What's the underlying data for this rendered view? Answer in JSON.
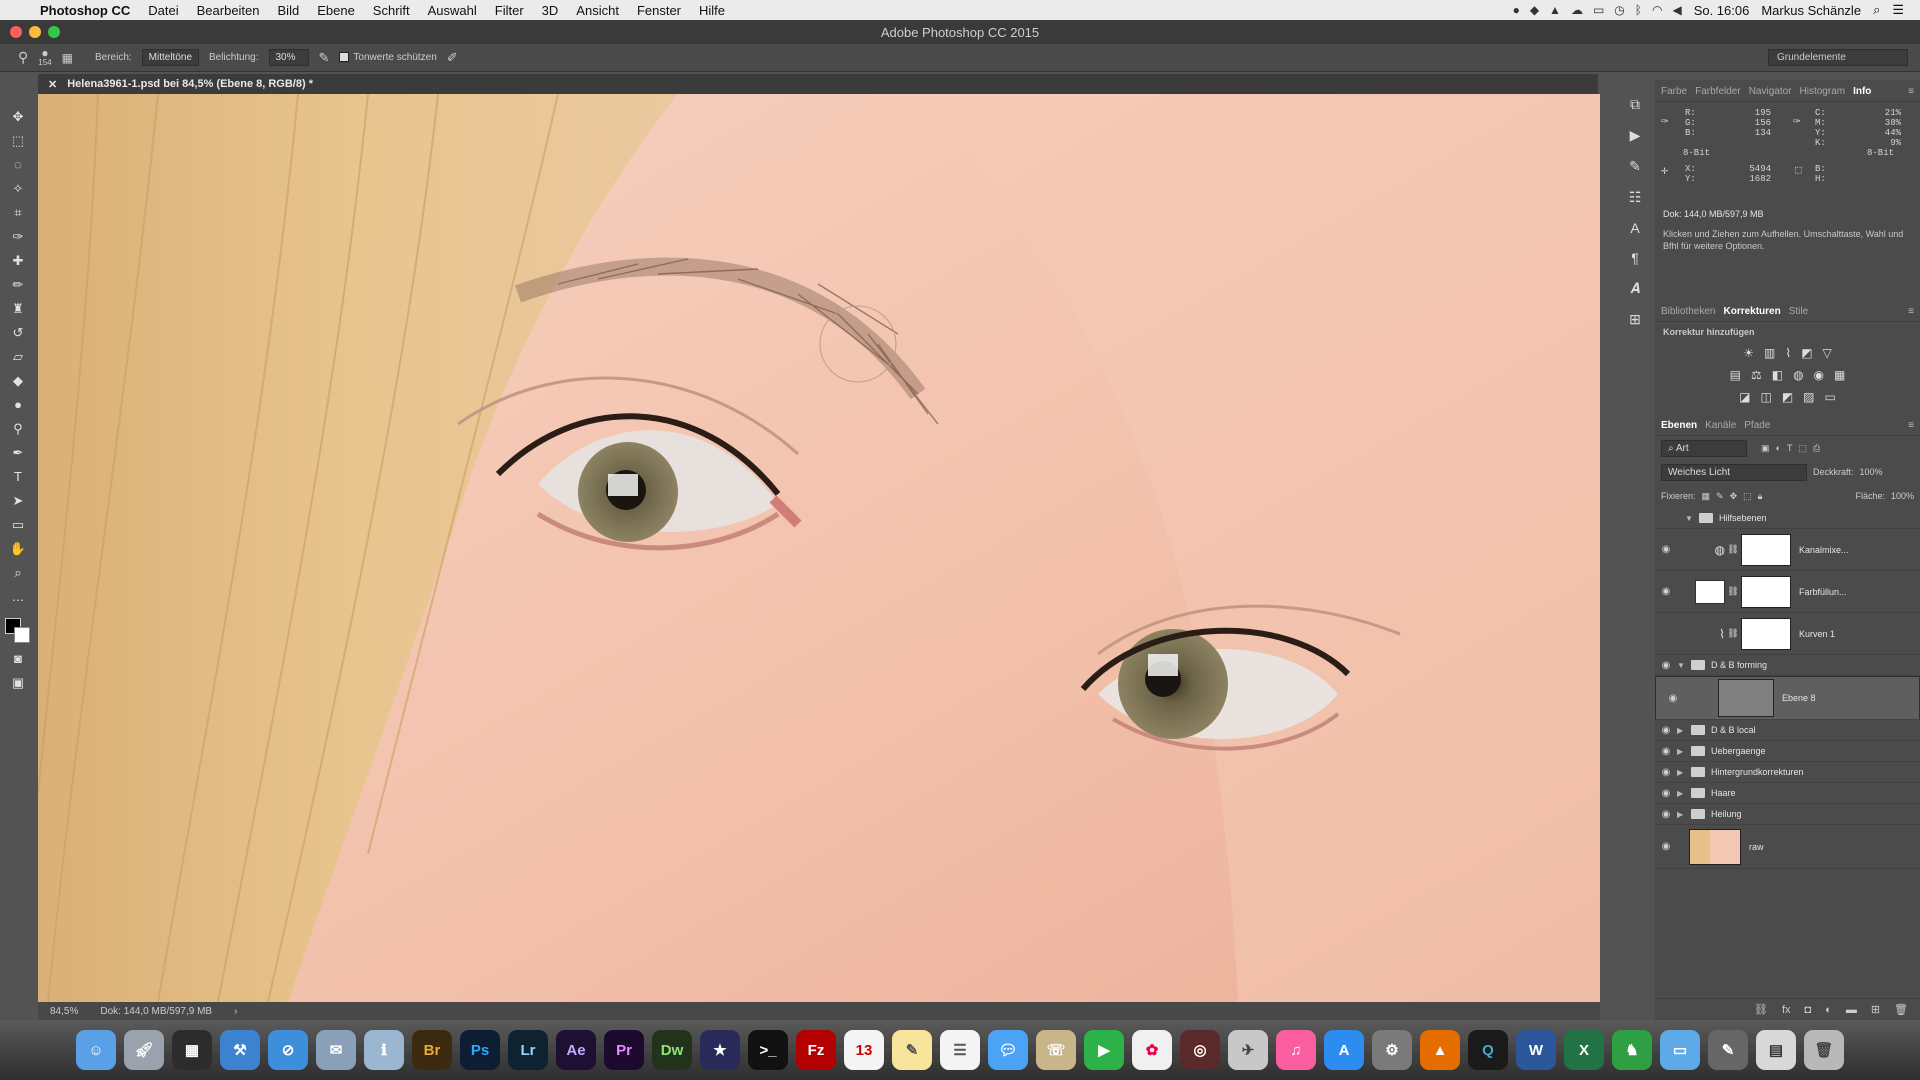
{
  "menubar": {
    "app_name": "Photoshop CC",
    "items": [
      "Datei",
      "Bearbeiten",
      "Bild",
      "Ebene",
      "Schrift",
      "Auswahl",
      "Filter",
      "3D",
      "Ansicht",
      "Fenster",
      "Hilfe"
    ],
    "clock": "So. 16:06",
    "user": "Markus Schänzle"
  },
  "window": {
    "title": "Adobe Photoshop CC 2015"
  },
  "options": {
    "brush_size": "154",
    "range_label": "Bereich:",
    "range_value": "Mitteltöne",
    "exposure_label": "Belichtung:",
    "exposure_value": "30%",
    "protect_tones": "Tonwerte schützen",
    "workspace": "Grundelemente"
  },
  "document": {
    "tab_title": "Helena3961-1.psd bei 84,5% (Ebene 8, RGB/8) *",
    "zoom": "84,5%",
    "doc_size": "Dok: 144,0 MB/597,9 MB"
  },
  "info_panel": {
    "tabs": [
      "Farbe",
      "Farbfelder",
      "Navigator",
      "Histogram",
      "Info"
    ],
    "active_tab": "Info",
    "rgb_labels": "R:\nG:\nB:",
    "rgb_values": "195\n156\n134",
    "cmyk_labels": "C:\nM:\nY:\nK:",
    "cmyk_values": "21%\n38%\n44%\n9%",
    "bit_left": "8-Bit",
    "bit_right": "8-Bit",
    "xy_labels": "X:\nY:",
    "xy_values": "5494\n1682",
    "wh_labels": "B:\nH:",
    "doc_size": "Dok: 144,0 MB/597,9 MB",
    "hint": "Klicken und Ziehen zum Aufhellen. Umschalttaste, Wahl und Bfhl für weitere Optionen."
  },
  "adjustments_panel": {
    "tabs": [
      "Bibliotheken",
      "Korrekturen",
      "Stile"
    ],
    "active_tab": "Korrekturen",
    "label": "Korrektur hinzufügen"
  },
  "layers_panel": {
    "tabs": [
      "Ebenen",
      "Kanäle",
      "Pfade"
    ],
    "active_tab": "Ebenen",
    "filter_kind": "Art",
    "blend_mode": "Weiches Licht",
    "opacity_label": "Deckkraft:",
    "opacity_value": "100%",
    "lock_label": "Fixieren:",
    "fill_label": "Fläche:",
    "fill_value": "100%",
    "layers": [
      {
        "name": "Hilfsebenen"
      },
      {
        "name": "Kanalmixe..."
      },
      {
        "name": "Farbfüllun..."
      },
      {
        "name": "Kurven 1"
      },
      {
        "name": "D & B forming"
      },
      {
        "name": "Ebene 8"
      },
      {
        "name": "D & B local"
      },
      {
        "name": "Uebergaenge"
      },
      {
        "name": "Hintergrundkorrekturen"
      },
      {
        "name": "Haare"
      },
      {
        "name": "Heilung"
      },
      {
        "name": "raw"
      }
    ]
  },
  "dock": {
    "labels": [
      "Br",
      "Ps",
      "Lr",
      "Ae",
      "Pr",
      "Dw"
    ]
  },
  "colors": {
    "photoshop_bg": "#535353",
    "panel_bg": "#4b4b4b",
    "skin": "#f2c2ae",
    "hair": "#e2b982",
    "iris": "#7c7356"
  }
}
